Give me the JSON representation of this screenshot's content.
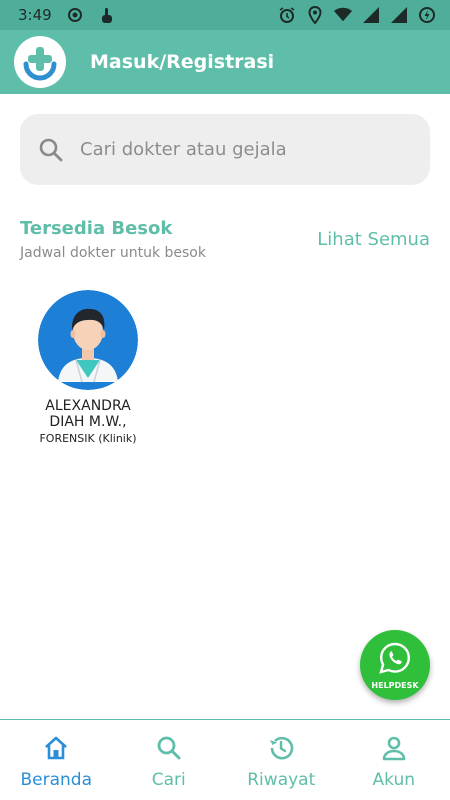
{
  "status_bar": {
    "time": "3:49"
  },
  "app_bar": {
    "title": "Masuk/Registrasi"
  },
  "search": {
    "placeholder": "Cari dokter atau gejala"
  },
  "section": {
    "title": "Tersedia Besok",
    "subtitle": "Jadwal dokter untuk besok",
    "see_all": "Lihat Semua"
  },
  "doctors": [
    {
      "name": "ALEXANDRA DIAH M.W.,",
      "specialty": "FORENSIK (Klinik)"
    }
  ],
  "fab": {
    "label": "HELPDESK"
  },
  "bottom_nav": {
    "items": [
      {
        "label": "Beranda",
        "icon": "home-icon",
        "active": true
      },
      {
        "label": "Cari",
        "icon": "search-icon",
        "active": false
      },
      {
        "label": "Riwayat",
        "icon": "history-icon",
        "active": false
      },
      {
        "label": "Akun",
        "icon": "account-icon",
        "active": false
      }
    ]
  },
  "colors": {
    "primary": "#5fbea9",
    "active_nav": "#2b8fd8",
    "helpdesk": "#2fbf3a"
  }
}
